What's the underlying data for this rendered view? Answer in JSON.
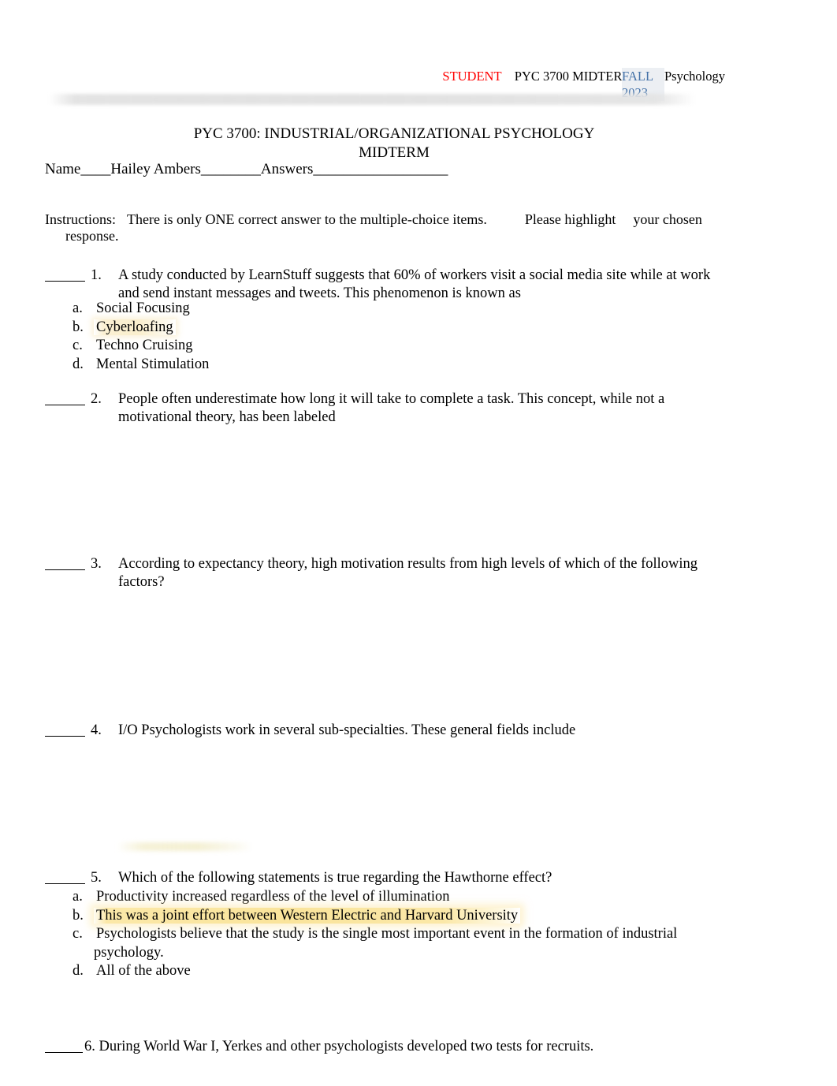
{
  "header": {
    "student_label": "STUDENT",
    "course_info": "PYC 3700   MIDTERM :  I/O Psychology",
    "term": "FALL 2023"
  },
  "title": {
    "line1": "PYC 3700:    INDUSTRIAL/ORGANIZATIONAL PSYCHOLOGY",
    "line2": "MIDTERM"
  },
  "name_line": {
    "label": "Name",
    "blank1": "____",
    "student_name": "Hailey Ambers",
    "blank2": "________",
    "answers_label": "Answers",
    "blank3": "__________________",
    "full": "Name____Hailey Ambers________Answers__________________"
  },
  "instructions": {
    "label": "Instructions:",
    "body": "There is only ONE correct answer to the multiple-choice items.",
    "tail1": "Please highlight",
    "tail2": "your",
    "tail3": "chosen",
    "tail4": "response."
  },
  "questions": [
    {
      "number": "1.",
      "text": "A study conducted by LearnStuff suggests that 60% of workers visit a social media site while at work and send instant messages and tweets. This phenomenon is known as",
      "options": [
        {
          "letter": "a.",
          "text": "Social Focusing",
          "highlight": "none"
        },
        {
          "letter": "b.",
          "text": "Cyberloafing",
          "highlight": "soft"
        },
        {
          "letter": "c.",
          "text": "Techno Cruising",
          "highlight": "none"
        },
        {
          "letter": "d.",
          "text": "Mental Stimulation",
          "highlight": "none"
        }
      ]
    },
    {
      "number": "2.",
      "text": "People often underestimate how long it will take to complete a task. This concept, while not a motivational theory, has been labeled",
      "options": []
    },
    {
      "number": "3.",
      "text": "According to expectancy theory, high motivation results from high levels of which of the following factors?",
      "options": []
    },
    {
      "number": "4.",
      "text": "I/O Psychologists work in several sub-specialties. These general fields include",
      "options": []
    },
    {
      "number": "5.",
      "text": "Which of the following statements is true regarding the Hawthorne effect?",
      "options": [
        {
          "letter": "a.",
          "text": "Productivity increased regardless of the level of illumination",
          "highlight": "none"
        },
        {
          "letter": "b.",
          "text": "This was a joint effort between Western Electric and Harvard University",
          "highlight": "strong"
        },
        {
          "letter": "c.",
          "text": "Psychologists believe that the study is the single most important event in the formation of industrial psychology.",
          "highlight": "none"
        },
        {
          "letter": "d.",
          "text": "All of the above",
          "highlight": "none"
        }
      ]
    },
    {
      "number": "6.",
      "text": "During World War I, Yerkes and other psychologists developed two tests for recruits.",
      "options": []
    }
  ],
  "colors": {
    "student_red": "#ff0000",
    "term_blue": "#4472a8",
    "term_background": "#eceff3",
    "header_band_gray": "#e2e2e2",
    "highlight_soft": "#faeecb",
    "highlight_strong": "#fae49b"
  }
}
